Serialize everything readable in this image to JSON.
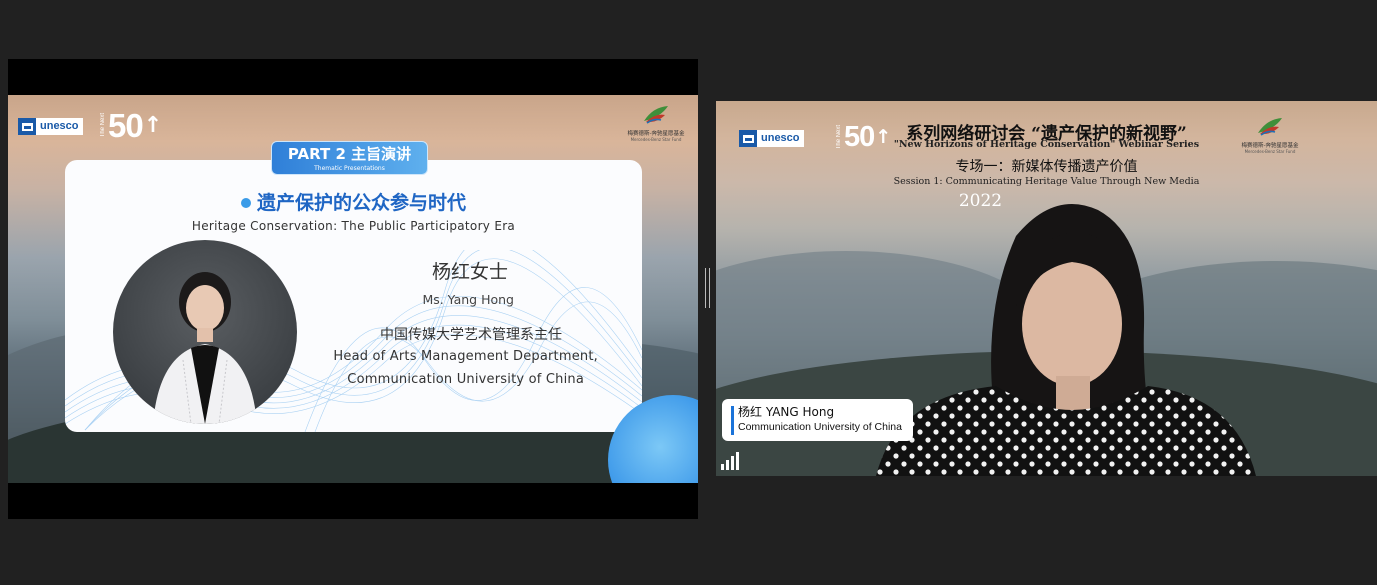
{
  "shared_screen": {
    "logos": {
      "unesco": "unesco",
      "the_next_small": "The Next",
      "the_next_big": "50",
      "foundation_cn": "梅赛德斯-奔驰星愿基金",
      "foundation_en": "Mercedes-Benz Star Fund"
    },
    "part_badge": {
      "main": "PART 2  主旨演讲",
      "sub": "Thematic Presentations"
    },
    "talk": {
      "title_zh": "遗产保护的公众参与时代",
      "title_en": "Heritage Conservation: The Public Participatory Era"
    },
    "speaker": {
      "name_zh": "杨红女士",
      "name_en": "Ms. Yang Hong",
      "title_zh": "中国传媒大学艺术管理系主任",
      "title_en_line1": "Head of Arts Management Department,",
      "title_en_line2": "Communication University of China"
    }
  },
  "camera_feed": {
    "logos": {
      "unesco": "unesco",
      "the_next_small": "The Next",
      "the_next_big": "50",
      "foundation_cn": "梅赛德斯-奔驰星愿基金",
      "foundation_en": "Mercedes-Benz Star Fund"
    },
    "background_text": {
      "title_zh": "系列网络研讨会 “遗产保护的新视野”",
      "title_en": "\"New Horizons of Heritage Conservation\" Webinar Series",
      "session_zh": "专场一：新媒体传播遗产价值",
      "session_en": "Session 1:  Communicating Heritage Value Through New Media",
      "year": "2022"
    },
    "participant": {
      "name": "杨红 YANG Hong",
      "organization": "Communication University of China"
    }
  },
  "colors": {
    "app_background": "#212121",
    "accent_blue": "#1a73d9",
    "slide_title_blue": "#1f66c4"
  },
  "icons": [
    "unesco-logo-icon",
    "the-next-50-logo-icon",
    "star-fund-logo-icon",
    "signal-strength-icon",
    "divider-drag-handle-icon"
  ]
}
